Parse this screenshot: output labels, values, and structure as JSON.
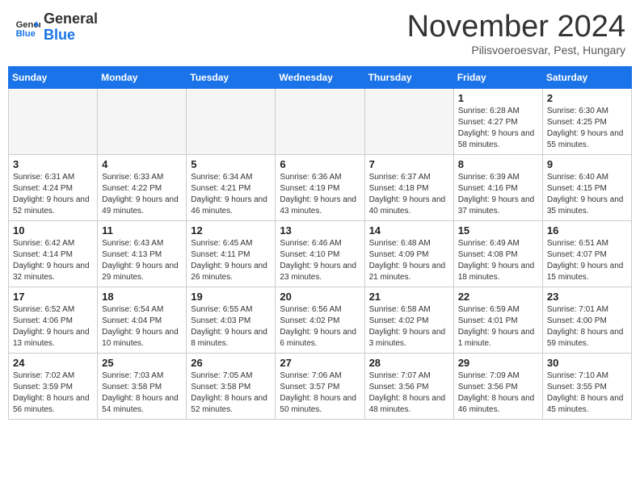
{
  "header": {
    "logo_line1": "General",
    "logo_line2": "Blue",
    "month": "November 2024",
    "location": "Pilisvoeroesvar, Pest, Hungary"
  },
  "weekdays": [
    "Sunday",
    "Monday",
    "Tuesday",
    "Wednesday",
    "Thursday",
    "Friday",
    "Saturday"
  ],
  "weeks": [
    [
      {
        "day": "",
        "detail": ""
      },
      {
        "day": "",
        "detail": ""
      },
      {
        "day": "",
        "detail": ""
      },
      {
        "day": "",
        "detail": ""
      },
      {
        "day": "",
        "detail": ""
      },
      {
        "day": "1",
        "detail": "Sunrise: 6:28 AM\nSunset: 4:27 PM\nDaylight: 9 hours\nand 58 minutes."
      },
      {
        "day": "2",
        "detail": "Sunrise: 6:30 AM\nSunset: 4:25 PM\nDaylight: 9 hours\nand 55 minutes."
      }
    ],
    [
      {
        "day": "3",
        "detail": "Sunrise: 6:31 AM\nSunset: 4:24 PM\nDaylight: 9 hours\nand 52 minutes."
      },
      {
        "day": "4",
        "detail": "Sunrise: 6:33 AM\nSunset: 4:22 PM\nDaylight: 9 hours\nand 49 minutes."
      },
      {
        "day": "5",
        "detail": "Sunrise: 6:34 AM\nSunset: 4:21 PM\nDaylight: 9 hours\nand 46 minutes."
      },
      {
        "day": "6",
        "detail": "Sunrise: 6:36 AM\nSunset: 4:19 PM\nDaylight: 9 hours\nand 43 minutes."
      },
      {
        "day": "7",
        "detail": "Sunrise: 6:37 AM\nSunset: 4:18 PM\nDaylight: 9 hours\nand 40 minutes."
      },
      {
        "day": "8",
        "detail": "Sunrise: 6:39 AM\nSunset: 4:16 PM\nDaylight: 9 hours\nand 37 minutes."
      },
      {
        "day": "9",
        "detail": "Sunrise: 6:40 AM\nSunset: 4:15 PM\nDaylight: 9 hours\nand 35 minutes."
      }
    ],
    [
      {
        "day": "10",
        "detail": "Sunrise: 6:42 AM\nSunset: 4:14 PM\nDaylight: 9 hours\nand 32 minutes."
      },
      {
        "day": "11",
        "detail": "Sunrise: 6:43 AM\nSunset: 4:13 PM\nDaylight: 9 hours\nand 29 minutes."
      },
      {
        "day": "12",
        "detail": "Sunrise: 6:45 AM\nSunset: 4:11 PM\nDaylight: 9 hours\nand 26 minutes."
      },
      {
        "day": "13",
        "detail": "Sunrise: 6:46 AM\nSunset: 4:10 PM\nDaylight: 9 hours\nand 23 minutes."
      },
      {
        "day": "14",
        "detail": "Sunrise: 6:48 AM\nSunset: 4:09 PM\nDaylight: 9 hours\nand 21 minutes."
      },
      {
        "day": "15",
        "detail": "Sunrise: 6:49 AM\nSunset: 4:08 PM\nDaylight: 9 hours\nand 18 minutes."
      },
      {
        "day": "16",
        "detail": "Sunrise: 6:51 AM\nSunset: 4:07 PM\nDaylight: 9 hours\nand 15 minutes."
      }
    ],
    [
      {
        "day": "17",
        "detail": "Sunrise: 6:52 AM\nSunset: 4:06 PM\nDaylight: 9 hours\nand 13 minutes."
      },
      {
        "day": "18",
        "detail": "Sunrise: 6:54 AM\nSunset: 4:04 PM\nDaylight: 9 hours\nand 10 minutes."
      },
      {
        "day": "19",
        "detail": "Sunrise: 6:55 AM\nSunset: 4:03 PM\nDaylight: 9 hours\nand 8 minutes."
      },
      {
        "day": "20",
        "detail": "Sunrise: 6:56 AM\nSunset: 4:02 PM\nDaylight: 9 hours\nand 6 minutes."
      },
      {
        "day": "21",
        "detail": "Sunrise: 6:58 AM\nSunset: 4:02 PM\nDaylight: 9 hours\nand 3 minutes."
      },
      {
        "day": "22",
        "detail": "Sunrise: 6:59 AM\nSunset: 4:01 PM\nDaylight: 9 hours\nand 1 minute."
      },
      {
        "day": "23",
        "detail": "Sunrise: 7:01 AM\nSunset: 4:00 PM\nDaylight: 8 hours\nand 59 minutes."
      }
    ],
    [
      {
        "day": "24",
        "detail": "Sunrise: 7:02 AM\nSunset: 3:59 PM\nDaylight: 8 hours\nand 56 minutes."
      },
      {
        "day": "25",
        "detail": "Sunrise: 7:03 AM\nSunset: 3:58 PM\nDaylight: 8 hours\nand 54 minutes."
      },
      {
        "day": "26",
        "detail": "Sunrise: 7:05 AM\nSunset: 3:58 PM\nDaylight: 8 hours\nand 52 minutes."
      },
      {
        "day": "27",
        "detail": "Sunrise: 7:06 AM\nSunset: 3:57 PM\nDaylight: 8 hours\nand 50 minutes."
      },
      {
        "day": "28",
        "detail": "Sunrise: 7:07 AM\nSunset: 3:56 PM\nDaylight: 8 hours\nand 48 minutes."
      },
      {
        "day": "29",
        "detail": "Sunrise: 7:09 AM\nSunset: 3:56 PM\nDaylight: 8 hours\nand 46 minutes."
      },
      {
        "day": "30",
        "detail": "Sunrise: 7:10 AM\nSunset: 3:55 PM\nDaylight: 8 hours\nand 45 minutes."
      }
    ]
  ]
}
